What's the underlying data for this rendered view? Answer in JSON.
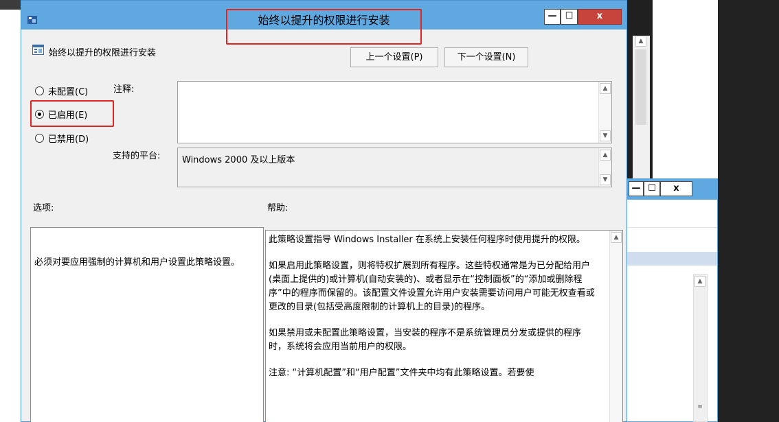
{
  "dialog": {
    "title": "始终以提升的权限进行安装",
    "controls": {
      "minimize": "—",
      "maximize": "☐",
      "close": "x"
    }
  },
  "policy": {
    "name": "始终以提升的权限进行安装",
    "prev_button": "上一个设置(P)",
    "next_button": "下一个设置(N)"
  },
  "state": {
    "options": [
      {
        "label": "未配置(C)",
        "checked": false
      },
      {
        "label": "已启用(E)",
        "checked": true
      },
      {
        "label": "已禁用(D)",
        "checked": false
      }
    ]
  },
  "comment": {
    "label": "注释:",
    "value": ""
  },
  "platform": {
    "label": "支持的平台:",
    "value": "Windows 2000 及以上版本"
  },
  "options_panel": {
    "label": "选项:",
    "text": "必须对要应用强制的计算机和用户设置此策略设置。"
  },
  "help_panel": {
    "label": "帮助:",
    "paragraphs": [
      "此策略设置指导 Windows Installer 在系统上安装任何程序时使用提升的权限。",
      "如果启用此策略设置，则将特权扩展到所有程序。这些特权通常是为已分配给用户(桌面上提供的)或计算机(自动安装的)、或者显示在“控制面板”的“添加或删除程序”中的程序而保留的。该配置文件设置允许用户安装需要访问用户可能无权查看或更改的目录(包括受高度限制的计算机上的目录)的程序。",
      "如果禁用或未配置此策略设置，当安装的程序不是系统管理员分发或提供的程序时，系统将会应用当前用户的权限。",
      "注意: “计算机配置”和“用户配置”文件夹中均有此策略设置。若要使"
    ]
  },
  "background_window": {
    "controls": {
      "minimize": "—",
      "maximize": "☐",
      "close": "x"
    }
  },
  "colors": {
    "titlebar": "#5fa8e0",
    "highlight": "#e52421",
    "close": "#c7443c"
  }
}
